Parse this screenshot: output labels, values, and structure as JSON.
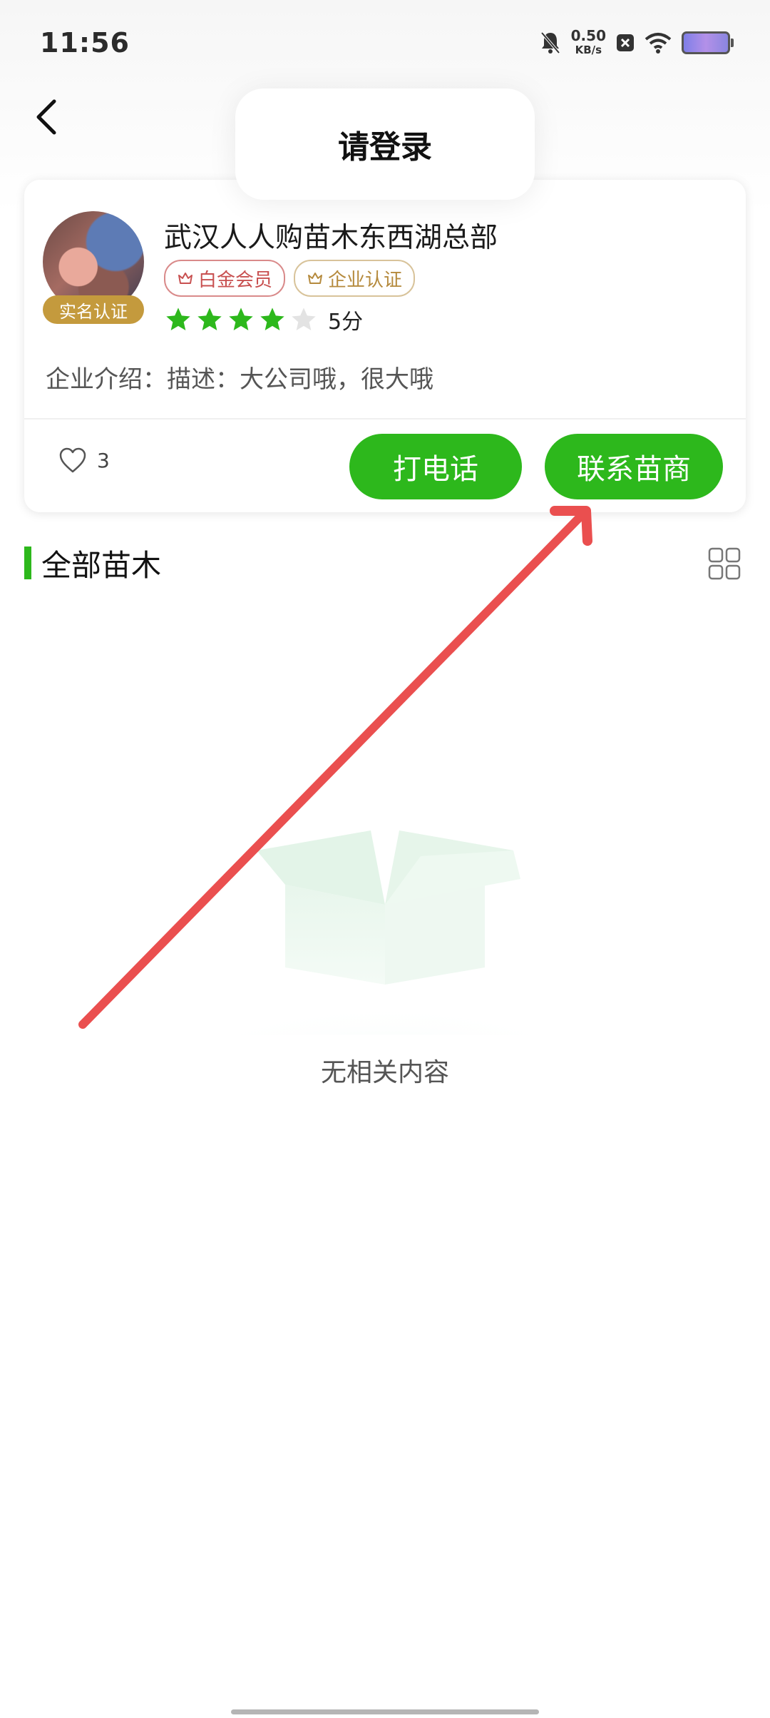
{
  "status_bar": {
    "time": "11:56",
    "net_speed_value": "0.50",
    "net_speed_unit": "KB/s",
    "icons": [
      "bell-off-icon",
      "close-box-icon",
      "wifi-icon",
      "battery-icon"
    ]
  },
  "header": {
    "back_icon": "chevron-left-icon",
    "toast": "请登录"
  },
  "company": {
    "name": "武汉人人购苗木东西湖总部",
    "verify_badge": "实名认证",
    "tags": [
      {
        "label": "白金会员",
        "icon": "crown-icon",
        "color": "#c85050"
      },
      {
        "label": "企业认证",
        "icon": "crown-icon",
        "color": "#b58a3d"
      }
    ],
    "rating": {
      "stars_filled": 4,
      "stars_total": 5,
      "score": "5分"
    },
    "intro": "企业介绍：描述：大公司哦，很大哦",
    "likes": "3",
    "call_button": "打电话",
    "contact_button": "联系苗商"
  },
  "section": {
    "title": "全部苗木"
  },
  "empty_state": {
    "text": "无相关内容"
  },
  "colors": {
    "primary_green": "#2db81c",
    "annotation_red": "#ea4f4f",
    "badge_gold": "#c49a3d"
  }
}
